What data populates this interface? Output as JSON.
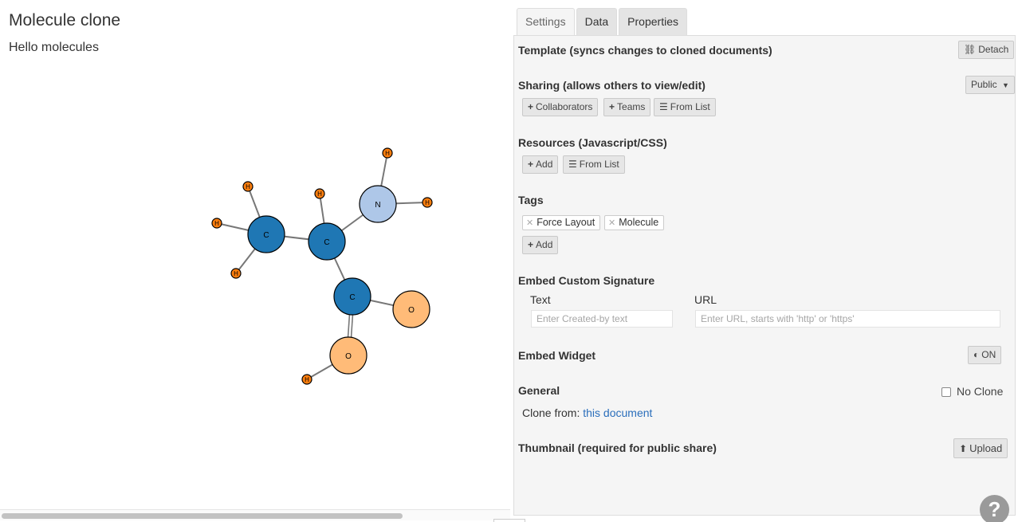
{
  "document": {
    "title": "Molecule clone",
    "subtitle": "Hello molecules"
  },
  "graph": {
    "nodes": [
      {
        "label": "C",
        "color": "#1f77b4"
      },
      {
        "label": "C",
        "color": "#1f77b4"
      },
      {
        "label": "N",
        "color": "#aec7e8"
      },
      {
        "label": "C",
        "color": "#1f77b4"
      },
      {
        "label": "O",
        "color": "#ffbb78"
      },
      {
        "label": "O",
        "color": "#ffbb78"
      },
      {
        "label": "H",
        "color": "#ff7f0e"
      },
      {
        "label": "H",
        "color": "#ff7f0e"
      },
      {
        "label": "H",
        "color": "#ff7f0e"
      },
      {
        "label": "H",
        "color": "#ff7f0e"
      },
      {
        "label": "H",
        "color": "#ff7f0e"
      },
      {
        "label": "H",
        "color": "#ff7f0e"
      },
      {
        "label": "H",
        "color": "#ff7f0e"
      }
    ],
    "bonds": [
      {
        "source": 0,
        "target": 1,
        "order": 1
      },
      {
        "source": 1,
        "target": 2,
        "order": 1
      },
      {
        "source": 1,
        "target": 3,
        "order": 1
      },
      {
        "source": 3,
        "target": 4,
        "order": 1
      },
      {
        "source": 3,
        "target": 5,
        "order": 2
      },
      {
        "source": 0,
        "target": 6,
        "order": 1
      },
      {
        "source": 0,
        "target": 7,
        "order": 1
      },
      {
        "source": 0,
        "target": 8,
        "order": 1
      },
      {
        "source": 1,
        "target": 9,
        "order": 1
      },
      {
        "source": 2,
        "target": 10,
        "order": 1
      },
      {
        "source": 2,
        "target": 11,
        "order": 1
      },
      {
        "source": 5,
        "target": 12,
        "order": 1
      }
    ]
  },
  "tabs": [
    {
      "label": "Settings",
      "active": true
    },
    {
      "label": "Data",
      "active": false
    },
    {
      "label": "Properties",
      "active": false
    }
  ],
  "settings": {
    "template": {
      "title": "Template (syncs changes to cloned documents)",
      "detach_label": "Detach"
    },
    "sharing": {
      "title": "Sharing (allows others to view/edit)",
      "visibility": "Public",
      "collaborators_label": "Collaborators",
      "teams_label": "Teams",
      "from_list_label": "From List"
    },
    "resources": {
      "title": "Resources (Javascript/CSS)",
      "add_label": "Add",
      "from_list_label": "From List"
    },
    "tags": {
      "title": "Tags",
      "items": [
        "Force Layout",
        "Molecule"
      ],
      "add_label": "Add"
    },
    "signature": {
      "title": "Embed Custom Signature",
      "text_label": "Text",
      "text_placeholder": "Enter Created-by text",
      "url_label": "URL",
      "url_placeholder": "Enter URL, starts with 'http' or 'https'"
    },
    "embed": {
      "title": "Embed Widget",
      "toggle_label": "ON"
    },
    "general": {
      "title": "General",
      "no_clone_label": "No Clone",
      "clone_from_label": "Clone from:",
      "clone_from_link": "this document"
    },
    "thumbnail": {
      "title": "Thumbnail (required for public share)",
      "upload_label": "Upload"
    }
  },
  "help": {
    "label": "?"
  }
}
